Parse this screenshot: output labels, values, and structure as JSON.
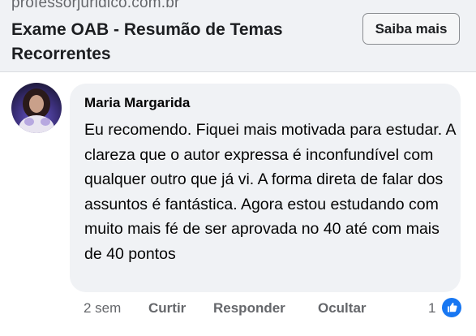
{
  "link_preview": {
    "domain": "professorjuridico.com.br",
    "title": "Exame OAB - Resumão de Temas Recorrentes",
    "cta_label": "Saiba mais"
  },
  "comment": {
    "author": "Maria Margarida",
    "text": "Eu recomendo. Fiquei mais motivada para estudar. A clareza que o autor expressa é inconfundível com qualquer outro que já vi. A forma direta de falar dos assuntos é fantástica. Agora estou estudando com muito mais fé de ser aprovada no 40 até com mais de 40 pontos",
    "timestamp": "2 sem",
    "actions": {
      "like": "Curtir",
      "reply": "Responder",
      "hide": "Ocultar"
    },
    "reaction_count": "1",
    "reaction_icon": "like-thumb-icon",
    "accent_color": "#1877f2"
  }
}
